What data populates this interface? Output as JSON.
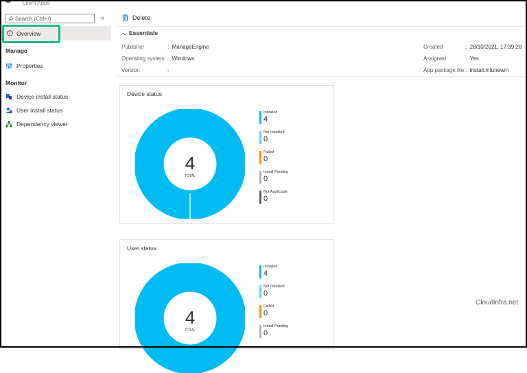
{
  "header": {
    "subtitle": "Client Apps"
  },
  "search": {
    "placeholder": "Search (Ctrl+/)"
  },
  "nav": {
    "collapse_label": "«",
    "overview": "Overview",
    "manage_heading": "Manage",
    "properties": "Properties",
    "monitor_heading": "Monitor",
    "device_install_status": "Device install status",
    "user_install_status": "User install status",
    "dependency_viewer": "Dependency viewer"
  },
  "toolbar": {
    "delete_label": "Delete"
  },
  "essentials": {
    "heading": "Essentials",
    "left": [
      {
        "label": "Publisher",
        "value": "ManageEngine"
      },
      {
        "label": "Operating system",
        "value": "Windows"
      },
      {
        "label": "Version",
        "value": ""
      }
    ],
    "right": [
      {
        "label": "Created",
        "value": "28/10/2021, 17:39:28"
      },
      {
        "label": "Assigned",
        "value": "Yes"
      },
      {
        "label": "App package file",
        "value": "install.intunewin"
      }
    ]
  },
  "device_status": {
    "title": "Device status",
    "total": "4",
    "total_label": "TOTAL",
    "legend": [
      {
        "label": "Installed",
        "value": "4",
        "color": "#00bcf2"
      },
      {
        "label": "Not Installed",
        "value": "0",
        "color": "#69d2f5"
      },
      {
        "label": "Failed",
        "value": "0",
        "color": "#ff8c00"
      },
      {
        "label": "Install Pending",
        "value": "0",
        "color": "#b3b0ad"
      },
      {
        "label": "Not Applicable",
        "value": "0",
        "color": "#605e5c"
      }
    ]
  },
  "user_status": {
    "title": "User status",
    "total": "4",
    "total_label": "TOTAL",
    "legend": [
      {
        "label": "Installed",
        "value": "4",
        "color": "#00bcf2"
      },
      {
        "label": "Not Installed",
        "value": "0",
        "color": "#69d2f5"
      },
      {
        "label": "Failed",
        "value": "0",
        "color": "#ff8c00"
      },
      {
        "label": "Install Pending",
        "value": "0",
        "color": "#b3b0ad"
      }
    ]
  },
  "watermark": "Cloudinfra.net",
  "colors": {
    "accent": "#00bcf2",
    "highlight": "#1cb78a"
  }
}
